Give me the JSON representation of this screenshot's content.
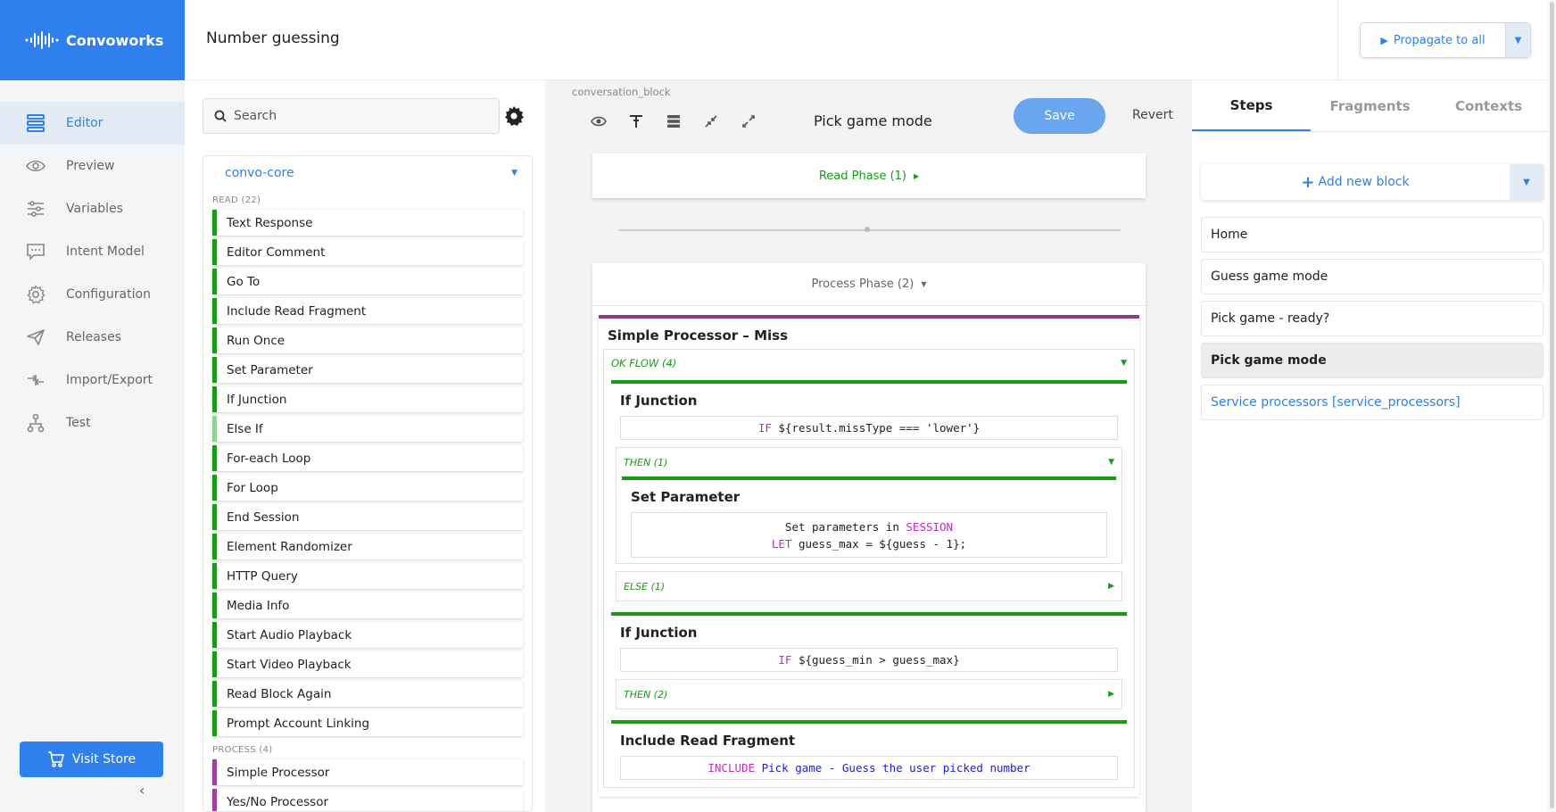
{
  "app": {
    "name": "Convoworks",
    "page_title": "Number guessing",
    "propagate_label": "Propagate to all"
  },
  "sidebar": {
    "items": [
      {
        "label": "Editor",
        "icon": "editor-icon",
        "active": true
      },
      {
        "label": "Preview",
        "icon": "eye-icon"
      },
      {
        "label": "Variables",
        "icon": "sliders-icon"
      },
      {
        "label": "Intent Model",
        "icon": "chat-icon"
      },
      {
        "label": "Configuration",
        "icon": "gear-icon"
      },
      {
        "label": "Releases",
        "icon": "send-icon"
      },
      {
        "label": "Import/Export",
        "icon": "import-export-icon"
      },
      {
        "label": "Test",
        "icon": "test-icon"
      }
    ],
    "visit_store": "Visit Store"
  },
  "components": {
    "search_placeholder": "Search",
    "package": "convo-core",
    "read_group": "READ (22)",
    "read_items": [
      "Text Response",
      "Editor Comment",
      "Go To",
      "Include Read Fragment",
      "Run Once",
      "Set Parameter",
      "If Junction",
      "Else If",
      "For-each Loop",
      "For Loop",
      "End Session",
      "Element Randomizer",
      "HTTP Query",
      "Media Info",
      "Start Audio Playback",
      "Start Video Playback",
      "Read Block Again",
      "Prompt Account Linking"
    ],
    "process_group": "PROCESS (4)",
    "process_items": [
      "Simple Processor",
      "Yes/No Processor"
    ]
  },
  "editor": {
    "block_type": "conversation_block",
    "block_name": "Pick game mode",
    "save_label": "Save",
    "revert_label": "Revert",
    "read_phase": "Read Phase (1)",
    "process_phase": "Process Phase (2)",
    "processor_title": "Simple Processor – Miss",
    "ok_flow": "OK FLOW (4)",
    "if1": {
      "title": "If Junction",
      "kw": "IF",
      "expr": " ${result.missType === 'lower'}"
    },
    "then1": "THEN (1)",
    "set_param": {
      "title": "Set Parameter",
      "line1_pre": "Set parameters in ",
      "line1_kw": "SESSION",
      "line2_kw": "LET",
      "line2_expr": " guess_max = ${guess - 1};"
    },
    "else1": "ELSE (1)",
    "if2": {
      "title": "If Junction",
      "kw": "IF",
      "expr": " ${guess_min > guess_max}"
    },
    "then2": "THEN (2)",
    "include": {
      "title": "Include Read Fragment",
      "kw": "INCLUDE",
      "str": " Pick game - Guess the user picked number"
    }
  },
  "right_panel": {
    "tabs": [
      "Steps",
      "Fragments",
      "Contexts"
    ],
    "add_block": "Add new block",
    "blocks": [
      {
        "label": "Home"
      },
      {
        "label": "Guess game mode"
      },
      {
        "label": "Pick game - ready?"
      },
      {
        "label": "Pick game mode",
        "active": true
      },
      {
        "label": "Service processors [service_processors]",
        "link": true
      }
    ]
  },
  "colors": {
    "accent": "#2f80ed",
    "read_element": "#1a9a1a",
    "process_element": "#8e3a8e",
    "keyword": "#c02cc0"
  }
}
